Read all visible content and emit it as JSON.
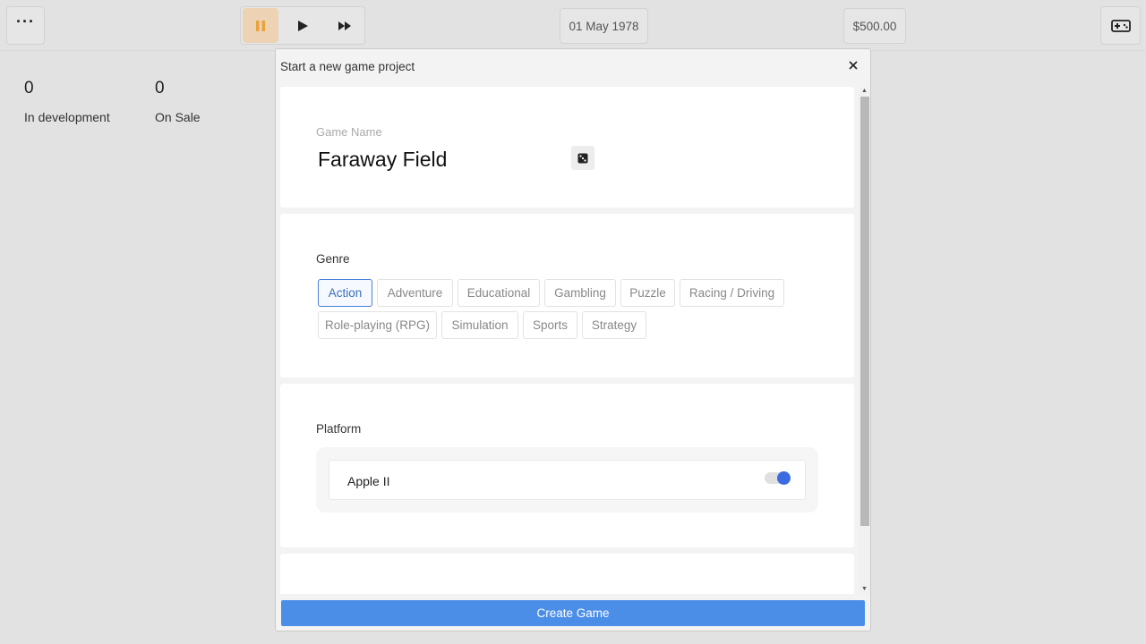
{
  "topbar": {
    "menu_icon": "ellipsis-icon",
    "speed_controls": [
      {
        "name": "pause",
        "icon": "pause-icon",
        "active": true
      },
      {
        "name": "play",
        "icon": "play-icon",
        "active": false
      },
      {
        "name": "fast-forward",
        "icon": "fast-forward-icon",
        "active": false
      }
    ],
    "date": "01 May 1978",
    "money": "$500.00",
    "right_icon": "gamepad-icon",
    "accent_color": "#e8a33d"
  },
  "stats": {
    "in_development": {
      "value": "0",
      "label": "In development"
    },
    "on_sale": {
      "value": "0",
      "label": "On Sale"
    }
  },
  "modal": {
    "title": "Start a new game project",
    "close_icon": "close-icon",
    "game_name": {
      "label": "Game Name",
      "value": "Faraway Field",
      "randomize_icon": "dice-icon"
    },
    "genre": {
      "label": "Genre",
      "options": [
        "Action",
        "Adventure",
        "Educational",
        "Gambling",
        "Puzzle",
        "Racing / Driving",
        "Role-playing (RPG)",
        "Simulation",
        "Sports",
        "Strategy"
      ],
      "selected": "Action"
    },
    "platform": {
      "label": "Platform",
      "items": [
        {
          "name": "Apple II",
          "enabled": true
        }
      ]
    },
    "create_button": "Create Game",
    "button_color": "#4b8ee8"
  }
}
